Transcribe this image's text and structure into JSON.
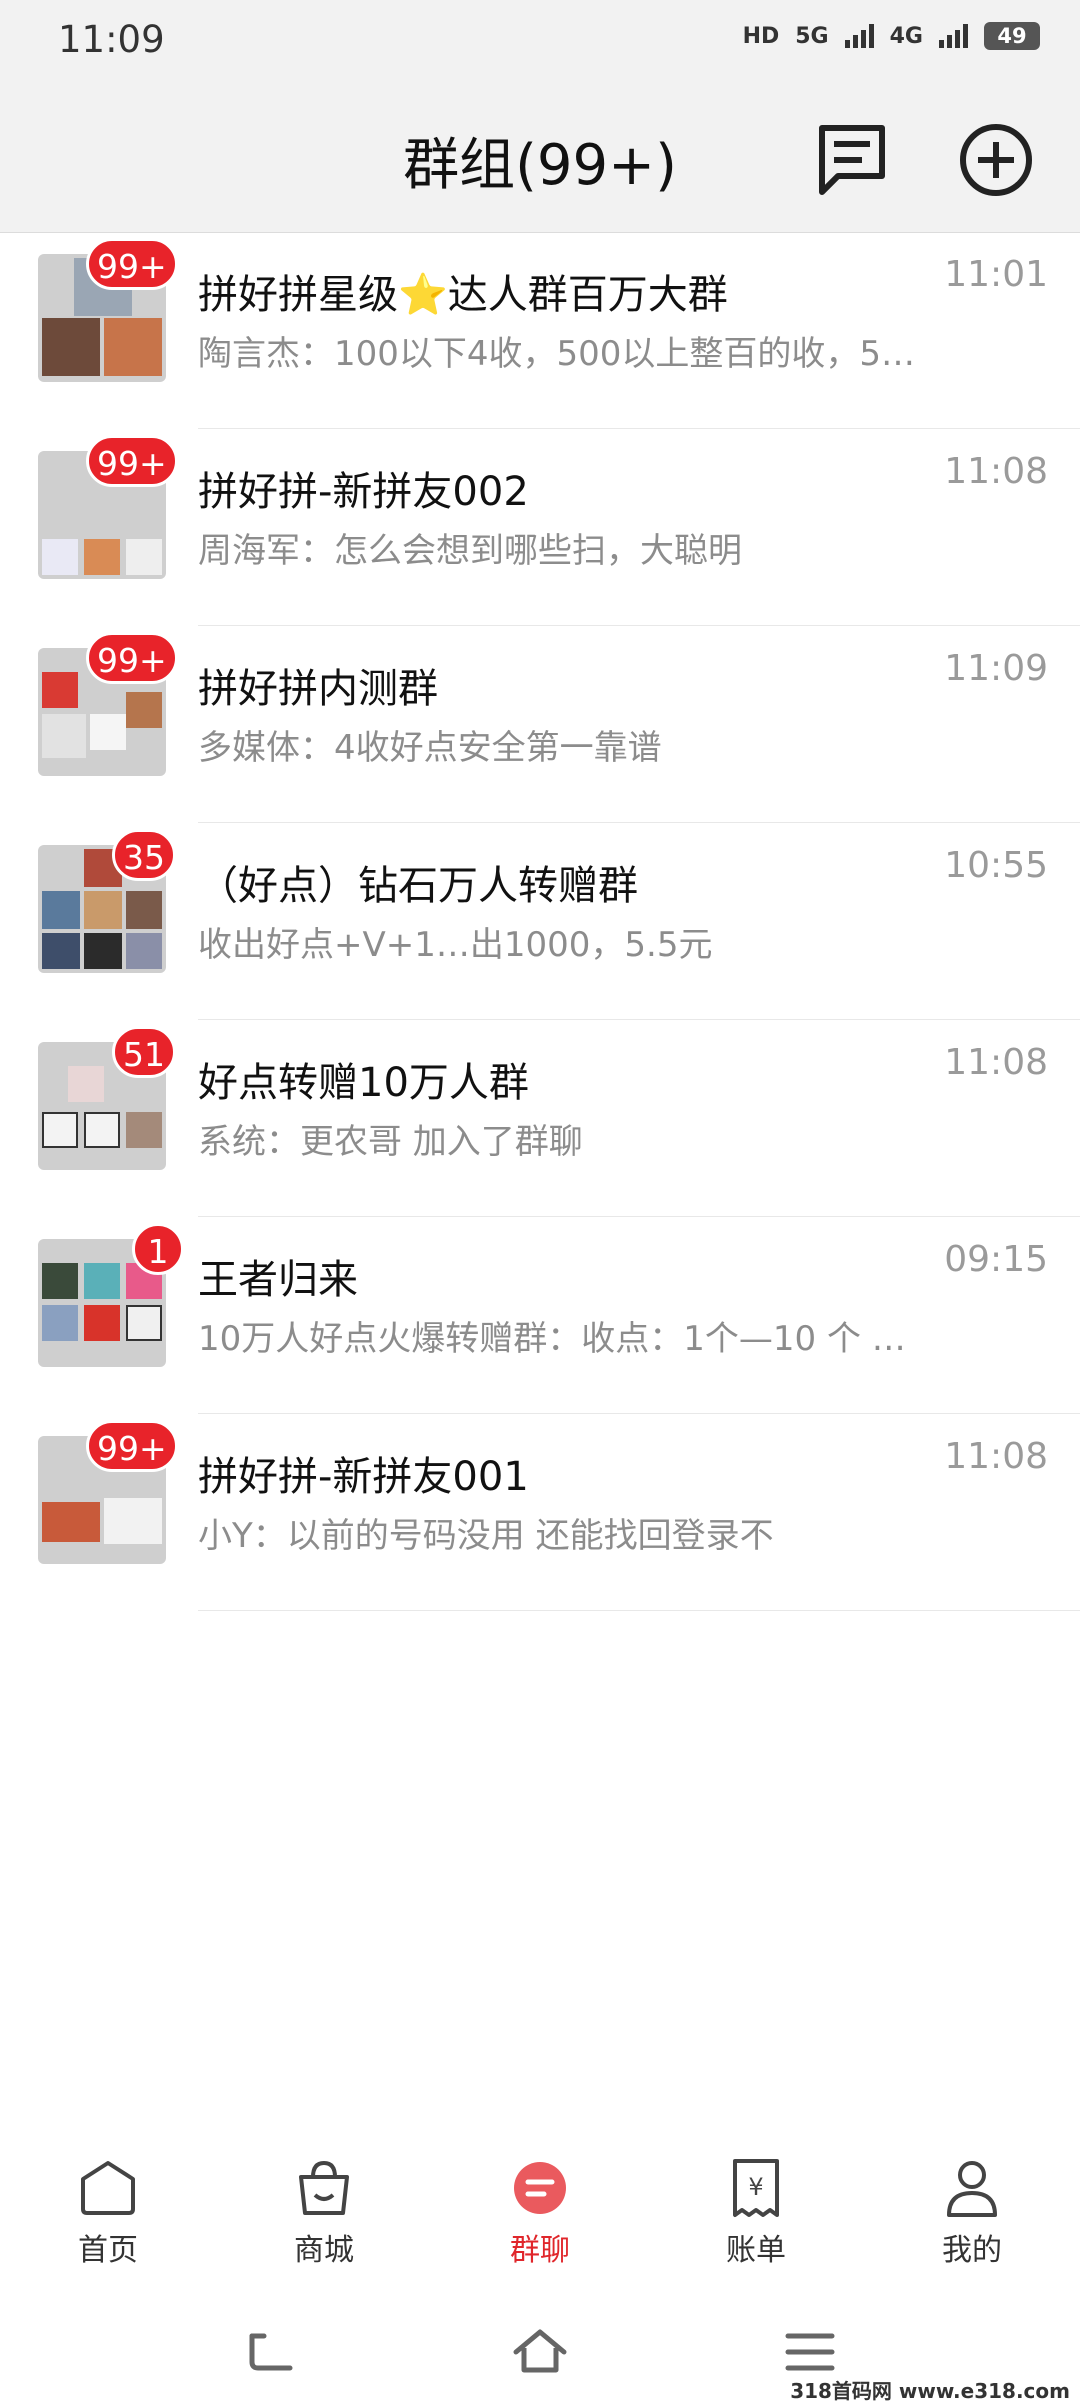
{
  "status": {
    "time": "11:09",
    "hd": "HD",
    "net1": "5G",
    "net2": "4G",
    "battery": "49"
  },
  "header": {
    "title": "群组(99+)",
    "icons": [
      "message-icon",
      "add-circle-icon"
    ]
  },
  "chats": [
    {
      "title": "拼好拼星级⭐达人群百万大群",
      "preview": "陶言杰：100以下4收，500以上整百的收，5…",
      "time": "11:01",
      "badge": "99+"
    },
    {
      "title": "拼好拼-新拼友002",
      "preview": "周海军：怎么会想到哪些扫，大聪明",
      "time": "11:08",
      "badge": "99+"
    },
    {
      "title": "拼好拼内测群",
      "preview": "多媒体：4收好点安全第一靠谱",
      "time": "11:09",
      "badge": "99+"
    },
    {
      "title": "（好点）钻石万人转赠群",
      "preview": "收出好点+V+1…出1000，5.5元",
      "time": "10:55",
      "badge": "35"
    },
    {
      "title": "好点转赠10万人群",
      "preview": "系统：更农哥 加入了群聊",
      "time": "11:08",
      "badge": "51"
    },
    {
      "title": "王者归来",
      "preview": "10万人好点火爆转赠群：收点：1个—10 个 …",
      "time": "09:15",
      "badge": "1"
    },
    {
      "title": "拼好拼-新拼友001",
      "preview": "小Y：以前的号码没用   还能找回登录不",
      "time": "11:08",
      "badge": "99+"
    }
  ],
  "nav": {
    "items": [
      {
        "label": "首页",
        "icon": "home-icon"
      },
      {
        "label": "商城",
        "icon": "shopping-bag-icon"
      },
      {
        "label": "群聊",
        "icon": "chat-bubble-icon"
      },
      {
        "label": "账单",
        "icon": "bill-icon"
      },
      {
        "label": "我的",
        "icon": "user-icon"
      }
    ],
    "active": "群聊"
  },
  "watermark": "318首码网 www.e318.com",
  "colors": {
    "accent": "#e0262b",
    "badge": "#e8232a",
    "header_bg": "#f2f2f2"
  }
}
